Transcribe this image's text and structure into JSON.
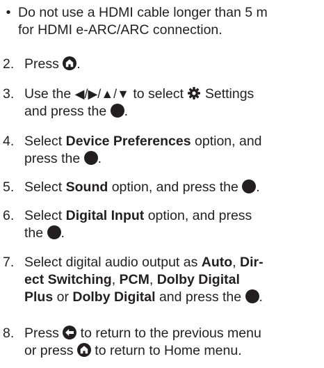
{
  "bullet": {
    "marker": "•",
    "line1": "Do not use a HDMI cable longer than 5 m",
    "line2": "for HDMI e-ARC/ARC connection."
  },
  "steps": [
    {
      "num": "2.",
      "pre": "Press ",
      "post": "."
    },
    {
      "num": "3.",
      "pre": "Use the ",
      "arrows": "◀/▶/▲/▼",
      "mid": " to select ",
      "settings": " Settings",
      "line2_pre": "and press the ",
      "post": "."
    },
    {
      "num": "4.",
      "pre": "Select ",
      "bold": "Device Preferences",
      "mid": " option, and",
      "line2_pre": "press the ",
      "post": "."
    },
    {
      "num": "5.",
      "pre": "Select ",
      "bold": "Sound",
      "mid": " option, and press the ",
      "post": "."
    },
    {
      "num": "6.",
      "pre": "Select ",
      "bold": "Digital Input",
      "mid": " option, and press",
      "line2_pre": "the ",
      "post": "."
    },
    {
      "num": "7.",
      "line1": "Select digital audio output as ",
      "auto": "Auto",
      "comma1": ", ",
      "dir": "Dir-",
      "ect": "ect Switching",
      "comma2": ", ",
      "pcm": "PCM",
      "comma3": ", ",
      "ddp1": "Dolby Digital",
      "ddp2": "Plus",
      "or": " or ",
      "dd": "Dolby Digital",
      "and": " and press the ",
      "post": "."
    },
    {
      "num": "8.",
      "pre": "Press ",
      "mid": " to return to the previous menu",
      "line2_pre": "or press ",
      "line2_post": " to return to Home menu."
    }
  ],
  "icons": {
    "home": "home-icon",
    "enter": "enter-button-icon",
    "gear": "gear-icon",
    "back": "back-icon"
  }
}
